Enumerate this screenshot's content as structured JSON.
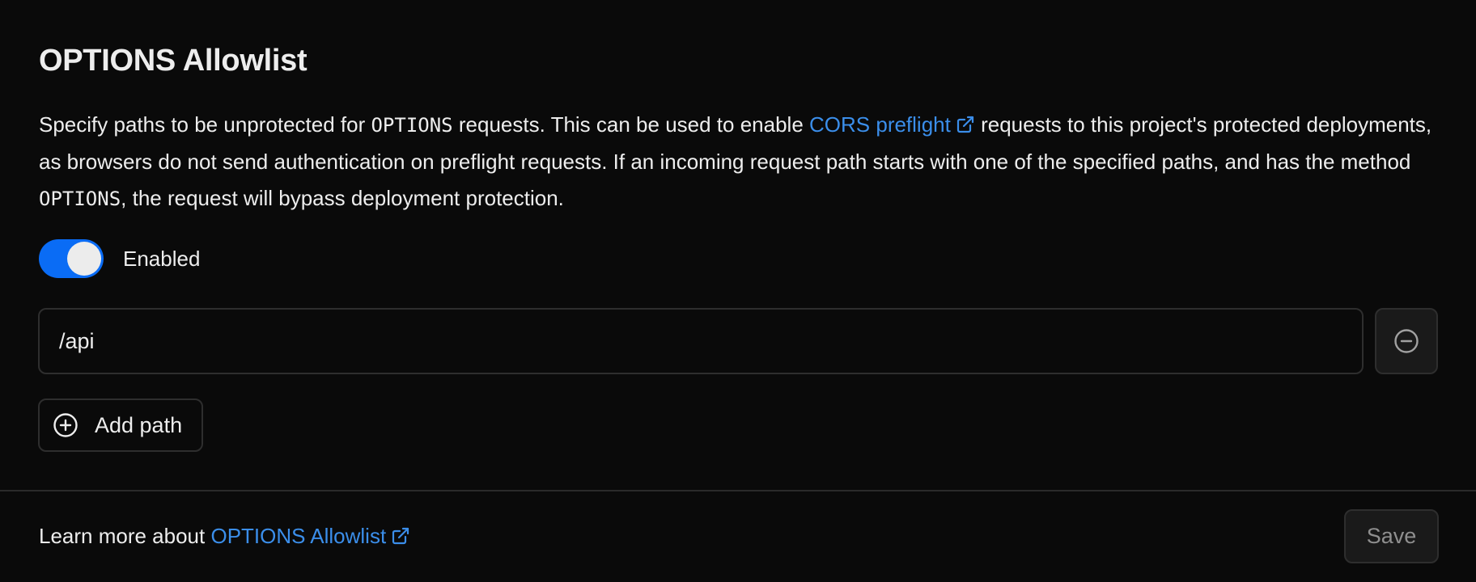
{
  "section": {
    "title": "OPTIONS Allowlist",
    "description": {
      "part1": "Specify paths to be unprotected for ",
      "code1": "OPTIONS",
      "part2": " requests. This can be used to enable ",
      "link_text": "CORS preflight",
      "part3": " requests to this project's protected deployments, as browsers do not send authentication on preflight requests. If an incoming request path starts with one of the specified paths, and has the method ",
      "code2": "OPTIONS",
      "part4": ", the request will bypass deployment protection."
    },
    "toggle": {
      "label": "Enabled",
      "state": "on"
    },
    "paths": [
      {
        "value": "/api"
      }
    ],
    "add_path_label": "Add path"
  },
  "footer": {
    "learn_more_prefix": "Learn more about ",
    "learn_more_link": "OPTIONS Allowlist",
    "save_label": "Save"
  },
  "icons": {
    "external_link": "external-link-icon",
    "remove": "minus-circle-icon",
    "add": "plus-circle-icon"
  },
  "colors": {
    "background": "#0a0a0a",
    "text": "#ededed",
    "link": "#3b8eea",
    "toggle_on": "#0a6cf5",
    "border": "#2e2e2e",
    "muted": "#8f8f8f"
  }
}
